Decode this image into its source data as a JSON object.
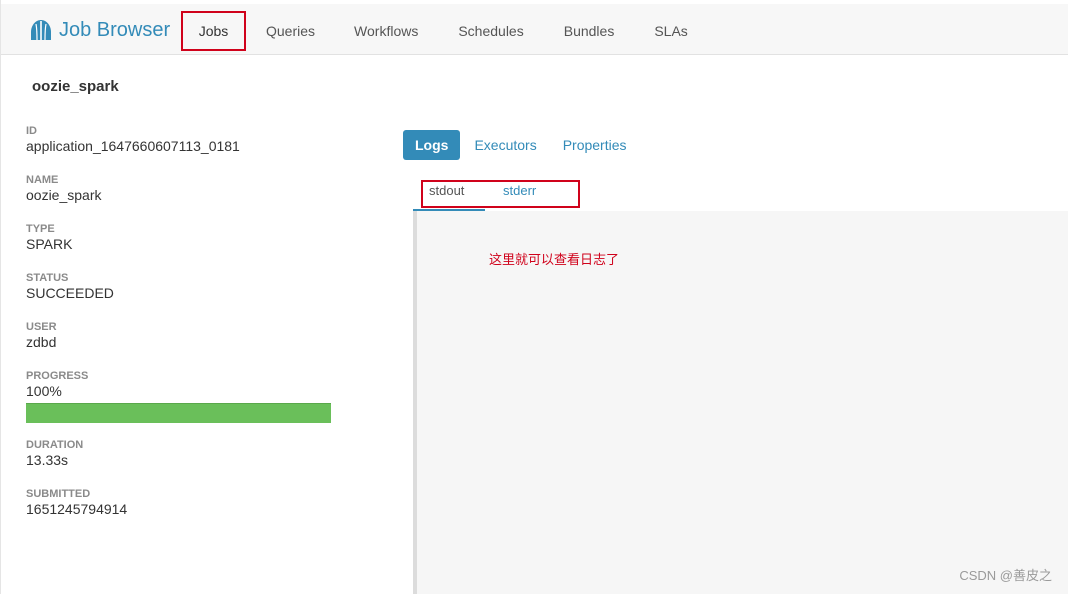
{
  "app": {
    "brand": "Job Browser",
    "logo_icon": "hue-logo-icon",
    "accent_color": "#338bb8",
    "highlight_color": "#d0021b"
  },
  "nav": {
    "jobs": "Jobs",
    "queries": "Queries",
    "workflows": "Workflows",
    "schedules": "Schedules",
    "bundles": "Bundles",
    "slas": "SLAs"
  },
  "job": {
    "title": "oozie_spark",
    "props": {
      "id": {
        "label": "ID",
        "value": "application_1647660607113_0181"
      },
      "name": {
        "label": "NAME",
        "value": "oozie_spark"
      },
      "type": {
        "label": "TYPE",
        "value": "SPARK"
      },
      "status": {
        "label": "STATUS",
        "value": "SUCCEEDED"
      },
      "user": {
        "label": "USER",
        "value": "zdbd"
      },
      "progress": {
        "label": "PROGRESS",
        "value": "100%",
        "fraction": 1.0
      },
      "duration": {
        "label": "DURATION",
        "value": "13.33s"
      },
      "submitted": {
        "label": "SUBMITTED",
        "value": "1651245794914"
      }
    }
  },
  "tabs": {
    "logs": "Logs",
    "executors": "Executors",
    "properties": "Properties"
  },
  "subtabs": {
    "stdout": "stdout",
    "stderr": "stderr"
  },
  "log": {
    "note": "这里就可以查看日志了"
  },
  "watermark": "CSDN @善皮之"
}
